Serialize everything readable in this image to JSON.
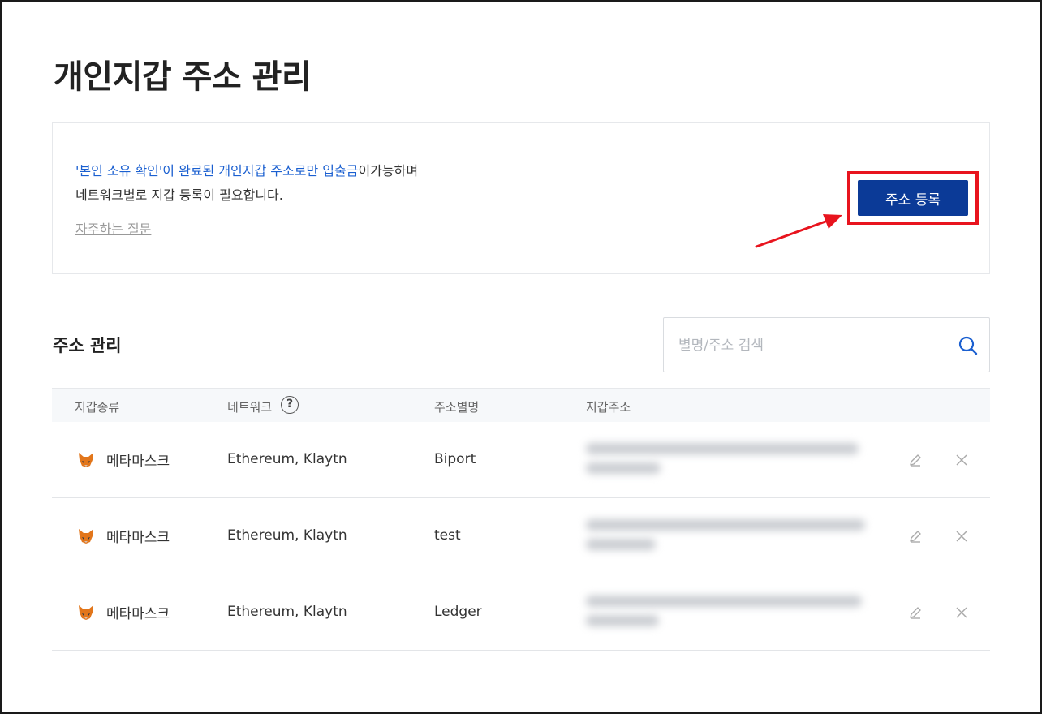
{
  "page": {
    "title": "개인지갑 주소 관리"
  },
  "notice": {
    "line1_part1": "'본인 소유 확인'이 완료된 개인지갑 주소로만 입출금",
    "line1_part2": "이가능하며",
    "line2": "네트워크별로 지갑 등록이 필요합니다.",
    "faq_link": "자주하는 질문"
  },
  "register_button": {
    "label": "주소 등록"
  },
  "address_section": {
    "title": "주소 관리",
    "search": {
      "placeholder": "별명/주소 검색"
    }
  },
  "table": {
    "headers": {
      "wallet_type": "지갑종류",
      "network": "네트워크",
      "alias": "주소별명",
      "address": "지갑주소"
    },
    "rows": [
      {
        "wallet_type": "메타마스크",
        "network": "Ethereum, Klaytn",
        "alias": "Biport"
      },
      {
        "wallet_type": "메타마스크",
        "network": "Ethereum, Klaytn",
        "alias": "test"
      },
      {
        "wallet_type": "메타마스크",
        "network": "Ethereum, Klaytn",
        "alias": "Ledger"
      }
    ]
  },
  "icons": {
    "wallet": "metamask-fox-icon",
    "help": "question-circle-icon",
    "search": "search-icon",
    "edit": "pencil-icon",
    "delete": "close-icon",
    "annotation": "red-arrow-icon"
  },
  "colors": {
    "brand_blue": "#0b3a97",
    "link_blue": "#1a5fd0",
    "annotation_red": "#e8141e"
  }
}
